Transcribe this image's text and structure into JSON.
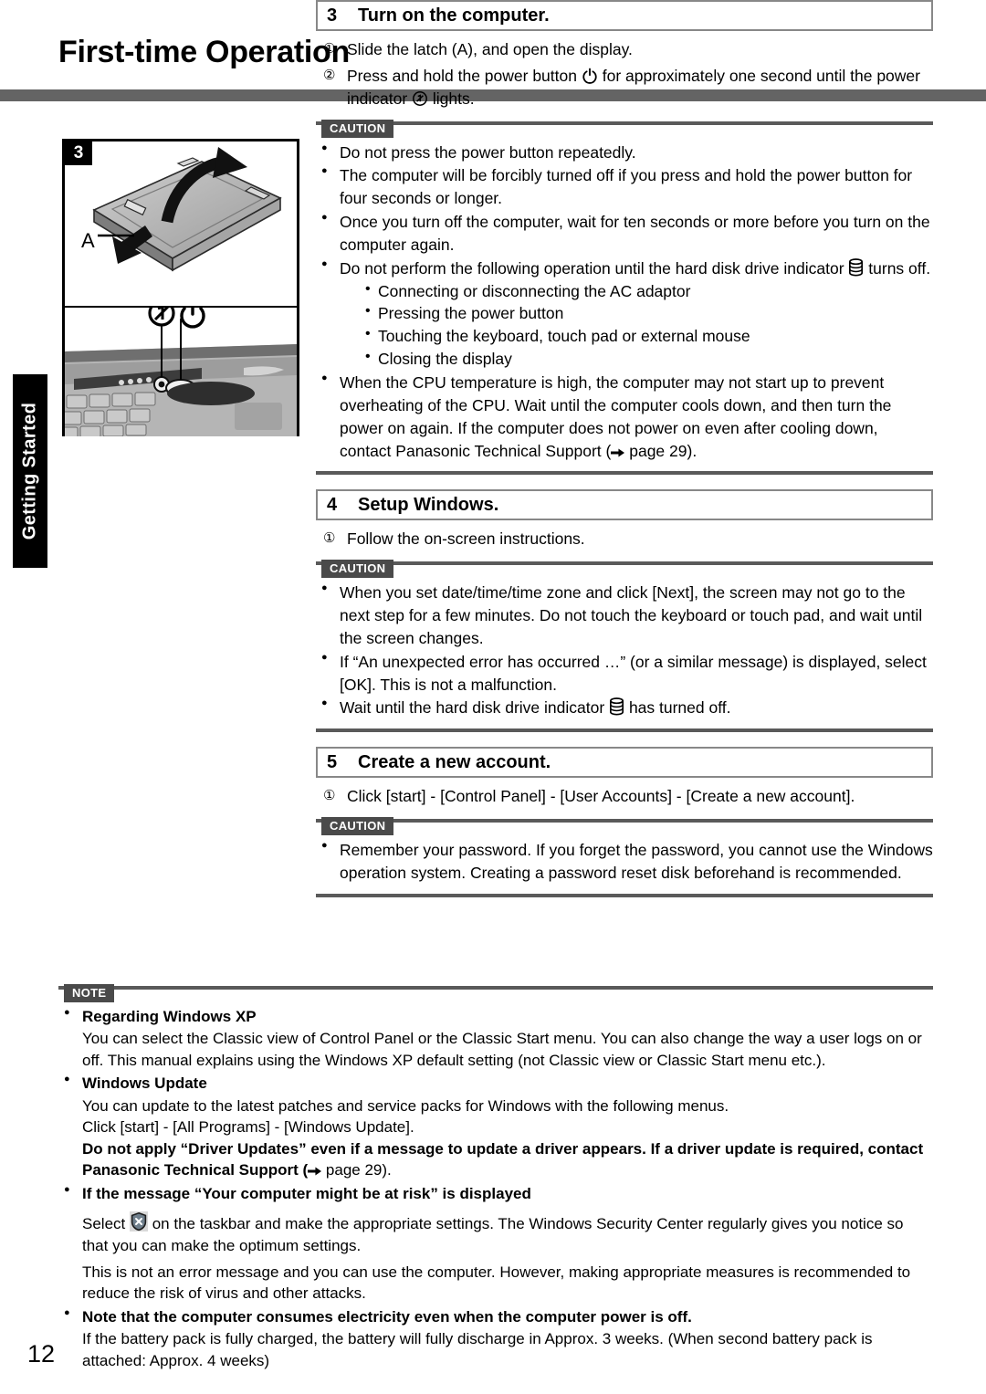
{
  "page": {
    "title": "First-time Operation",
    "number": "12",
    "side_tab": "Getting Started"
  },
  "figure": {
    "number": "3",
    "callout": "A",
    "icons": [
      "power-indicator-icon",
      "power-button-icon"
    ]
  },
  "steps": [
    {
      "number": "3",
      "title": "Turn on the computer.",
      "instructions": [
        {
          "marker": "①",
          "before": "Slide the latch (A), and open the display.",
          "icon": null,
          "after": ""
        },
        {
          "marker": "②",
          "before": "Press and hold the power button",
          "icon": "power-button-icon",
          "after": "for approximately one second until the power indicator",
          "icon2": "power-indicator-icon",
          "after2": "lights."
        }
      ],
      "caution_label": "CAUTION",
      "cautions": [
        {
          "text": "Do not press the power button repeatedly."
        },
        {
          "text": "The computer will be forcibly turned off if you press and hold the power button for four seconds or longer."
        },
        {
          "text": "Once you turn off the computer, wait for ten seconds or more before you turn on the computer again."
        },
        {
          "text_before": "Do not perform the following operation until the hard disk drive indicator",
          "icon": "hard-disk-drive-icon",
          "text_after": "turns off.",
          "sub": [
            "Connecting or disconnecting the AC adaptor",
            "Pressing the power button",
            "Touching the keyboard, touch pad or external mouse",
            "Closing the display"
          ]
        },
        {
          "text_before": "When the CPU temperature is high, the computer may not start up to prevent overheating of the CPU. Wait until the computer cools down, and then turn the power on again. If the computer does not power on even after cooling down, contact Panasonic Technical Support (",
          "icon": "arrow-right-icon",
          "text_after": "page 29)."
        }
      ]
    },
    {
      "number": "4",
      "title": "Setup Windows.",
      "instructions": [
        {
          "marker": "①",
          "before": "Follow the on-screen instructions.",
          "icon": null,
          "after": ""
        }
      ],
      "caution_label": "CAUTION",
      "cautions": [
        {
          "text": "When you set date/time/time zone and click [Next], the screen may not go to the next step for a few minutes. Do not touch the keyboard or touch pad, and wait until the screen changes."
        },
        {
          "text": "If “An unexpected error has occurred …” (or a similar message) is displayed, select [OK]. This is not a malfunction."
        },
        {
          "text_before": "Wait until the hard disk drive indicator",
          "icon": "hard-disk-drive-icon",
          "text_after": "has turned off."
        }
      ]
    },
    {
      "number": "5",
      "title": "Create a new account.",
      "instructions": [
        {
          "marker": "①",
          "before": "Click [start] - [Control Panel] - [User Accounts] - [Create a new account].",
          "icon": null,
          "after": ""
        }
      ],
      "caution_label": "CAUTION",
      "cautions": [
        {
          "text": "Remember your password. If you forget the password, you cannot use the Windows operation system. Creating a password reset disk beforehand is recommended."
        }
      ]
    }
  ],
  "note": {
    "label": "NOTE",
    "items": [
      {
        "heading": "Regarding Windows XP",
        "body": "You can select the Classic view of Control Panel or the Classic Start menu. You can also change the way a user logs on or off. This manual explains using the Windows XP default setting (not Classic view or Classic Start menu etc.)."
      },
      {
        "heading": "Windows Update",
        "body": "You can update to the latest patches and service packs for Windows with the following menus.",
        "body2": "Click [start] - [All Programs] - [Windows Update].",
        "bold_before": "Do not apply “Driver Updates” even if a message to update a driver appears. If a driver update is required, contact Panasonic Technical Support (",
        "bold_icon": "arrow-right-icon",
        "bold_after": "page 29)."
      },
      {
        "heading": "If the message “Your computer might be at risk” is displayed",
        "body_before": "Select",
        "body_icon": "security-shield-icon",
        "body_after": "on the taskbar and make the appropriate settings. The Windows Security Center regularly gives you notice so that you can make the optimum settings.",
        "body2": "This is not an error message and you can use the computer. However, making appropriate measures is recommended to reduce the risk of virus and other attacks."
      },
      {
        "heading": "Note that the computer consumes electricity even when the computer power is off.",
        "body": "If the battery pack is fully charged, the battery will fully discharge in Approx. 3 weeks. (When second battery pack is attached: Approx. 4 weeks)"
      }
    ]
  },
  "colors": {
    "header_rule": "#646464",
    "caution_rule": "#5a5a5a",
    "tag_bg": "#4a4a4a",
    "side_tab_bg": "#000000"
  }
}
